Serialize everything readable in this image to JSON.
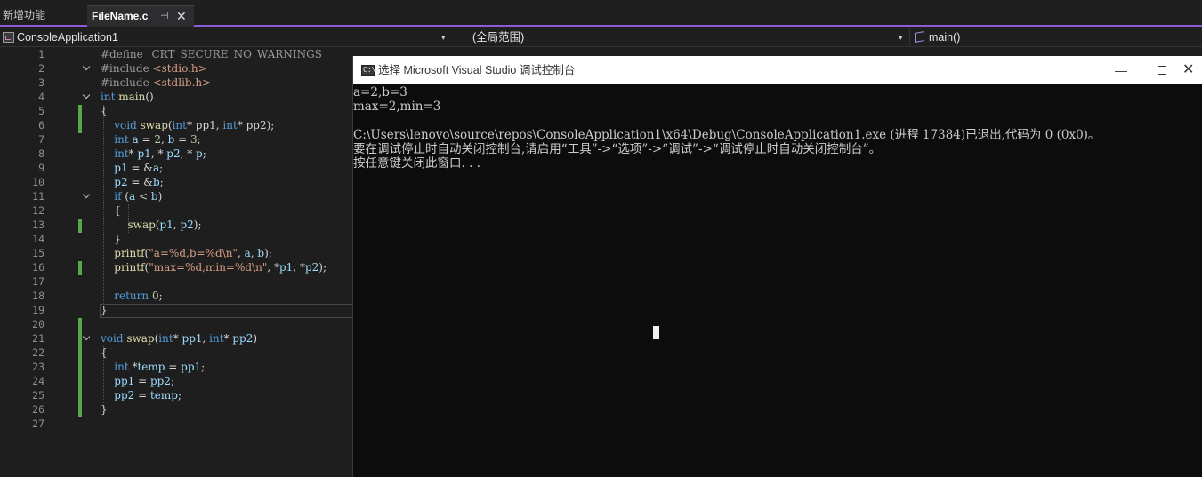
{
  "tabs": [
    {
      "label": "新增功能",
      "active": false
    },
    {
      "label": "FileName.c",
      "active": true,
      "pin_glyph": "⊣",
      "close_glyph": "✕"
    }
  ],
  "navbar": {
    "project": "ConsoleApplication1",
    "scope": "(全局范围)",
    "function": "main()",
    "dropdown_glyph": "▾"
  },
  "editor": {
    "line_numbers": [
      "1",
      "2",
      "3",
      "4",
      "5",
      "6",
      "7",
      "8",
      "9",
      "10",
      "11",
      "12",
      "13",
      "14",
      "15",
      "16",
      "17",
      "18",
      "19",
      "20",
      "21",
      "22",
      "23",
      "24",
      "25",
      "26",
      "27"
    ],
    "lines": [
      [
        {
          "t": "#define _CRT_SECURE_NO_WARNINGS",
          "c": "pp"
        }
      ],
      [
        {
          "t": "#include ",
          "c": "pp"
        },
        {
          "t": "<stdio.h>",
          "c": "str"
        }
      ],
      [
        {
          "t": "#include ",
          "c": "pp"
        },
        {
          "t": "<stdlib.h>",
          "c": "str"
        }
      ],
      [
        {
          "t": "int",
          "c": "kw"
        },
        {
          "t": " ",
          "c": "plain"
        },
        {
          "t": "main",
          "c": "fn"
        },
        {
          "t": "()",
          "c": "plain"
        }
      ],
      [
        {
          "t": "{",
          "c": "plain"
        }
      ],
      [
        {
          "t": "    void ",
          "c": "kw"
        },
        {
          "t": "swap",
          "c": "fn"
        },
        {
          "t": "(",
          "c": "plain"
        },
        {
          "t": "int",
          "c": "kw"
        },
        {
          "t": "* pp1, ",
          "c": "plain"
        },
        {
          "t": "int",
          "c": "kw"
        },
        {
          "t": "* pp2);",
          "c": "plain"
        }
      ],
      [
        {
          "t": "    int ",
          "c": "kw"
        },
        {
          "t": "a",
          "c": "var"
        },
        {
          "t": " = ",
          "c": "plain"
        },
        {
          "t": "2",
          "c": "num"
        },
        {
          "t": ", ",
          "c": "plain"
        },
        {
          "t": "b",
          "c": "var"
        },
        {
          "t": " = ",
          "c": "plain"
        },
        {
          "t": "3",
          "c": "num"
        },
        {
          "t": ";",
          "c": "plain"
        }
      ],
      [
        {
          "t": "    int",
          "c": "kw"
        },
        {
          "t": "* ",
          "c": "plain"
        },
        {
          "t": "p1",
          "c": "var"
        },
        {
          "t": ", * ",
          "c": "plain"
        },
        {
          "t": "p2",
          "c": "var"
        },
        {
          "t": ", * ",
          "c": "plain"
        },
        {
          "t": "p",
          "c": "var"
        },
        {
          "t": ";",
          "c": "plain"
        }
      ],
      [
        {
          "t": "    p1",
          "c": "var"
        },
        {
          "t": " = &",
          "c": "plain"
        },
        {
          "t": "a",
          "c": "var"
        },
        {
          "t": ";",
          "c": "plain"
        }
      ],
      [
        {
          "t": "    p2",
          "c": "var"
        },
        {
          "t": " = &",
          "c": "plain"
        },
        {
          "t": "b",
          "c": "var"
        },
        {
          "t": ";",
          "c": "plain"
        }
      ],
      [
        {
          "t": "    if",
          "c": "kw"
        },
        {
          "t": " (",
          "c": "plain"
        },
        {
          "t": "a",
          "c": "var"
        },
        {
          "t": " < ",
          "c": "plain"
        },
        {
          "t": "b",
          "c": "var"
        },
        {
          "t": ")",
          "c": "plain"
        }
      ],
      [
        {
          "t": "    {",
          "c": "plain"
        }
      ],
      [
        {
          "t": "        ",
          "c": "plain"
        },
        {
          "t": "swap",
          "c": "fn"
        },
        {
          "t": "(",
          "c": "plain"
        },
        {
          "t": "p1",
          "c": "var"
        },
        {
          "t": ", ",
          "c": "plain"
        },
        {
          "t": "p2",
          "c": "var"
        },
        {
          "t": ");",
          "c": "plain"
        }
      ],
      [
        {
          "t": "    }",
          "c": "plain"
        }
      ],
      [
        {
          "t": "    ",
          "c": "plain"
        },
        {
          "t": "printf",
          "c": "fn"
        },
        {
          "t": "(",
          "c": "plain"
        },
        {
          "t": "\"a=%d,b=%d\\n\"",
          "c": "str"
        },
        {
          "t": ", ",
          "c": "plain"
        },
        {
          "t": "a",
          "c": "var"
        },
        {
          "t": ", ",
          "c": "plain"
        },
        {
          "t": "b",
          "c": "var"
        },
        {
          "t": ");",
          "c": "plain"
        }
      ],
      [
        {
          "t": "    ",
          "c": "plain"
        },
        {
          "t": "printf",
          "c": "fn"
        },
        {
          "t": "(",
          "c": "plain"
        },
        {
          "t": "\"max=%d,min=%d\\n\"",
          "c": "str"
        },
        {
          "t": ", *",
          "c": "plain"
        },
        {
          "t": "p1",
          "c": "var"
        },
        {
          "t": ", *",
          "c": "plain"
        },
        {
          "t": "p2",
          "c": "var"
        },
        {
          "t": ");",
          "c": "plain"
        }
      ],
      [
        {
          "t": "",
          "c": "plain"
        }
      ],
      [
        {
          "t": "    return ",
          "c": "kw"
        },
        {
          "t": "0",
          "c": "num"
        },
        {
          "t": ";",
          "c": "plain"
        }
      ],
      [
        {
          "t": "}",
          "c": "plain"
        }
      ],
      [
        {
          "t": "",
          "c": "plain"
        }
      ],
      [
        {
          "t": "void ",
          "c": "kw"
        },
        {
          "t": "swap",
          "c": "fn"
        },
        {
          "t": "(",
          "c": "plain"
        },
        {
          "t": "int",
          "c": "kw"
        },
        {
          "t": "* ",
          "c": "plain"
        },
        {
          "t": "pp1",
          "c": "var"
        },
        {
          "t": ", ",
          "c": "plain"
        },
        {
          "t": "int",
          "c": "kw"
        },
        {
          "t": "* ",
          "c": "plain"
        },
        {
          "t": "pp2",
          "c": "var"
        },
        {
          "t": ")",
          "c": "plain"
        }
      ],
      [
        {
          "t": "{",
          "c": "plain"
        }
      ],
      [
        {
          "t": "    int ",
          "c": "kw"
        },
        {
          "t": "*",
          "c": "plain"
        },
        {
          "t": "temp",
          "c": "var"
        },
        {
          "t": " = ",
          "c": "plain"
        },
        {
          "t": "pp1",
          "c": "var"
        },
        {
          "t": ";",
          "c": "plain"
        }
      ],
      [
        {
          "t": "    pp1",
          "c": "var"
        },
        {
          "t": " = ",
          "c": "plain"
        },
        {
          "t": "pp2",
          "c": "var"
        },
        {
          "t": ";",
          "c": "plain"
        }
      ],
      [
        {
          "t": "    pp2",
          "c": "var"
        },
        {
          "t": " = ",
          "c": "plain"
        },
        {
          "t": "temp",
          "c": "var"
        },
        {
          "t": ";",
          "c": "plain"
        }
      ],
      [
        {
          "t": "}",
          "c": "plain"
        }
      ],
      [
        {
          "t": "",
          "c": "plain"
        }
      ]
    ],
    "fold_lines": [
      2,
      4,
      11,
      21
    ],
    "changed_lines": [
      5,
      6,
      13,
      16,
      20,
      21,
      22,
      23,
      24,
      25,
      26
    ],
    "current_line": 19
  },
  "console": {
    "title": "选择 Microsoft Visual Studio 调试控制台",
    "icon_text": "C:\\",
    "min_glyph": "—",
    "close_glyph": "✕",
    "lines": [
      "a=2,b=3",
      "max=2,min=3",
      "",
      "C:\\Users\\lenovo\\source\\repos\\ConsoleApplication1\\x64\\Debug\\ConsoleApplication1.exe (进程 17384)已退出,代码为 0 (0x0)。",
      "要在调试停止时自动关闭控制台,请启用“工具”->“选项”->“调试”->“调试停止时自动关闭控制台”。",
      "按任意键关闭此窗口. . ."
    ]
  },
  "colors": {
    "accent": "#8a5cd6",
    "change_bar": "#57a64a",
    "keyword": "#569cd6",
    "string": "#d69d85",
    "function": "#dcdcaa",
    "variable": "#9cdcfe",
    "number": "#b5cea8"
  }
}
